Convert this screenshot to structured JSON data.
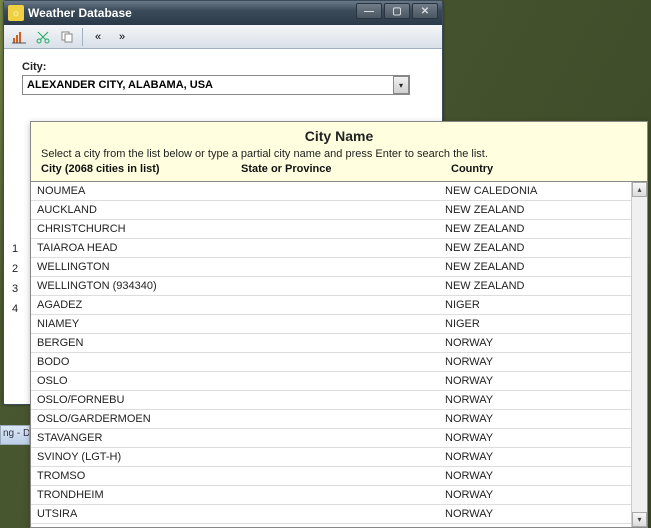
{
  "window": {
    "title": "Weather Database",
    "toolbar": {
      "btn1_icon": "chart-icon",
      "btn2_icon": "scissors-icon",
      "btn3_icon": "copy-icon",
      "nav_prev_label": "«",
      "nav_next_label": "»"
    },
    "city_label": "City:",
    "city_value": "ALEXANDER CITY, ALABAMA, USA",
    "side_hints": [
      "1",
      "2",
      "3",
      "4"
    ]
  },
  "popup": {
    "title": "City Name",
    "instruction": "Select a city from the list below or type a partial city name and press Enter to search the list.",
    "columns": {
      "city": "City (2068 cities in list)",
      "state": "State or Province",
      "country": "Country"
    },
    "rows": [
      {
        "city": "NOUMEA",
        "country": "NEW CALEDONIA"
      },
      {
        "city": "AUCKLAND",
        "country": "NEW ZEALAND"
      },
      {
        "city": "CHRISTCHURCH",
        "country": "NEW ZEALAND"
      },
      {
        "city": "TAIAROA HEAD",
        "country": "NEW ZEALAND"
      },
      {
        "city": "WELLINGTON",
        "country": "NEW ZEALAND"
      },
      {
        "city": "WELLINGTON (934340)",
        "country": "NEW ZEALAND"
      },
      {
        "city": "AGADEZ",
        "country": "NIGER"
      },
      {
        "city": "NIAMEY",
        "country": "NIGER"
      },
      {
        "city": "BERGEN",
        "country": "NORWAY"
      },
      {
        "city": "BODO",
        "country": "NORWAY"
      },
      {
        "city": "OSLO",
        "country": "NORWAY"
      },
      {
        "city": "OSLO/FORNEBU",
        "country": "NORWAY"
      },
      {
        "city": "OSLO/GARDERMOEN",
        "country": "NORWAY"
      },
      {
        "city": "STAVANGER",
        "country": "NORWAY"
      },
      {
        "city": "SVINOY (LGT-H)",
        "country": "NORWAY"
      },
      {
        "city": "TROMSO",
        "country": "NORWAY"
      },
      {
        "city": "TRONDHEIM",
        "country": "NORWAY"
      },
      {
        "city": "UTSIRA",
        "country": "NORWAY"
      }
    ]
  },
  "taskbar_hint": "ng - D"
}
